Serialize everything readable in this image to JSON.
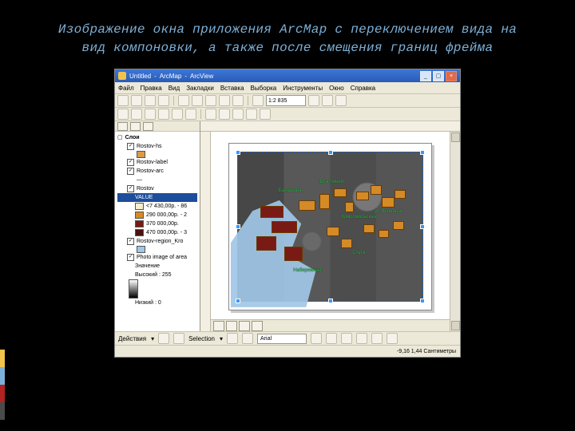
{
  "slide_title": "Изображение окна приложения ArcMap с переключением вида на вид компоновки, а также после смещения границ фрейма",
  "titlebar": {
    "doc": "Untitled",
    "app": "ArcMap",
    "edition": "ArcView"
  },
  "menubar": [
    "Файл",
    "Правка",
    "Вид",
    "Закладки",
    "Вставка",
    "Выборка",
    "Инструменты",
    "Окно",
    "Справка"
  ],
  "scale": "1:2 835",
  "toc": {
    "root": "Слои",
    "layers": [
      {
        "name": "Rostov-hs",
        "checked": true
      },
      {
        "name": "Rostov-label",
        "checked": true
      },
      {
        "name": "Rostov-arc",
        "checked": true
      },
      {
        "name": "Rostov",
        "checked": true
      }
    ],
    "value_header": "VALUE",
    "classes": [
      {
        "label": "<7 430,00p. - 86",
        "color": "#f6efcf"
      },
      {
        "label": "290 000,00p. - 2",
        "color": "#d48a27"
      },
      {
        "label": "370 000,00p.",
        "color": "#7a1a15"
      },
      {
        "label": "470 000,00p. - 3",
        "color": "#4a1210"
      }
    ],
    "region": {
      "name": "Rostov-region_Kro",
      "checked": true,
      "swatch": "#9fc7e6"
    },
    "raster": {
      "name": "Photo image of area",
      "checked": true,
      "sub": "Значение",
      "high": "Высокий : 255",
      "low": "Низкий : 0"
    }
  },
  "labels": [
    "Балашова",
    "18-я линия",
    "Комсомольская",
    "Набережная",
    "Спуск",
    "ул.Энгельса"
  ],
  "bottombar": {
    "actions": "Действия",
    "selection": "Selection",
    "font": "Arial"
  },
  "status": "-9,16 1,44 Сантиметры"
}
